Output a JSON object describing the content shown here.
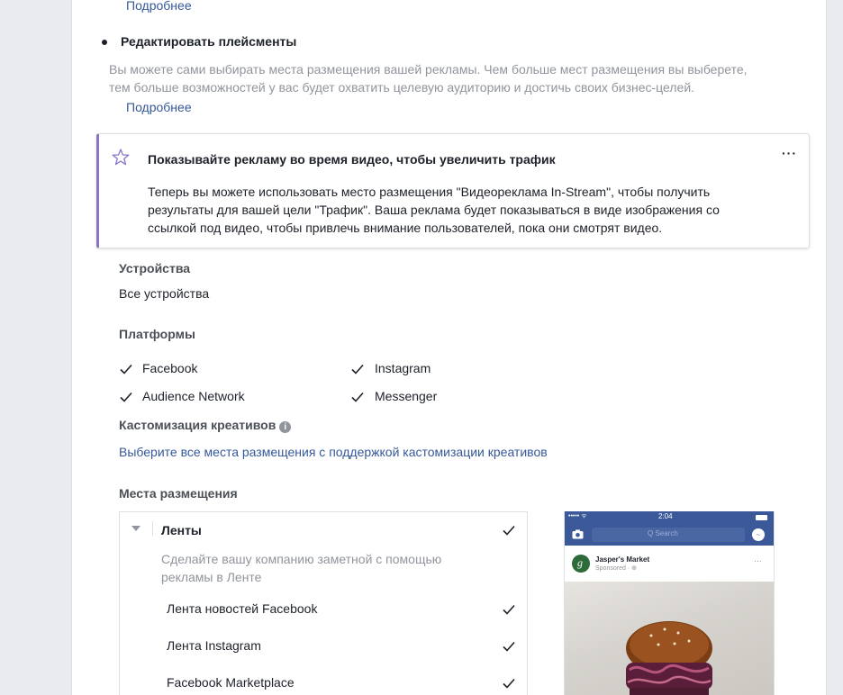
{
  "top": {
    "more_link": "Подробнее"
  },
  "edit_placements": {
    "label": "Редактировать плейсменты",
    "description_line1": "Вы можете сами выбирать места размещения вашей рекламы. Чем больше мест размещения вы выберете,",
    "description_line2": "тем больше возможностей у вас будет охватить целевую аудиторию и достичь своих бизнес-целей.",
    "more_link": "Подробнее"
  },
  "tip": {
    "title": "Показывайте рекламу во время видео, чтобы увеличить трафик",
    "menu_label": "···",
    "line1": "Теперь вы можете использовать место размещения \"Видеореклама In-Stream\", чтобы получить",
    "line2": "результаты для вашей цели \"Трафик\". Ваша реклама будет показываться в виде изображения со",
    "line3": "ссылкой под видео, чтобы привлечь внимание пользователей, пока они смотрят видео.",
    "accent_color": "#8c72cb"
  },
  "devices": {
    "heading": "Устройства",
    "value": "Все устройства"
  },
  "platforms": {
    "heading": "Платформы",
    "items": [
      {
        "label": "Facebook",
        "checked": true
      },
      {
        "label": "Instagram",
        "checked": true
      },
      {
        "label": "Audience Network",
        "checked": true
      },
      {
        "label": "Messenger",
        "checked": true
      }
    ]
  },
  "customization": {
    "heading": "Кастомизация креативов",
    "info_icon": "info-icon",
    "link": "Выберите все места размещения с поддержкой кастомизации креативов"
  },
  "placements": {
    "heading": "Места размещения",
    "group": {
      "title": "Ленты",
      "desc_line1": "Сделайте вашу компанию заметной с помощью",
      "desc_line2": "рекламы в Ленте",
      "checked": true
    },
    "items": [
      {
        "label": "Лента новостей Facebook",
        "checked": true
      },
      {
        "label": "Лента Instagram",
        "checked": true
      },
      {
        "label": "Facebook Marketplace",
        "checked": true
      }
    ]
  },
  "preview": {
    "status_time": "2:04",
    "status_signal": "••••• ᯤ",
    "search_placeholder": "Q Search",
    "advertiser": "Jasper's Market",
    "sponsored": "Sponsored · ⊕",
    "post_menu": "···",
    "brand_color": "#3b5998"
  },
  "colors": {
    "link": "#365899",
    "text": "#1d2129",
    "muted": "#90949c"
  }
}
